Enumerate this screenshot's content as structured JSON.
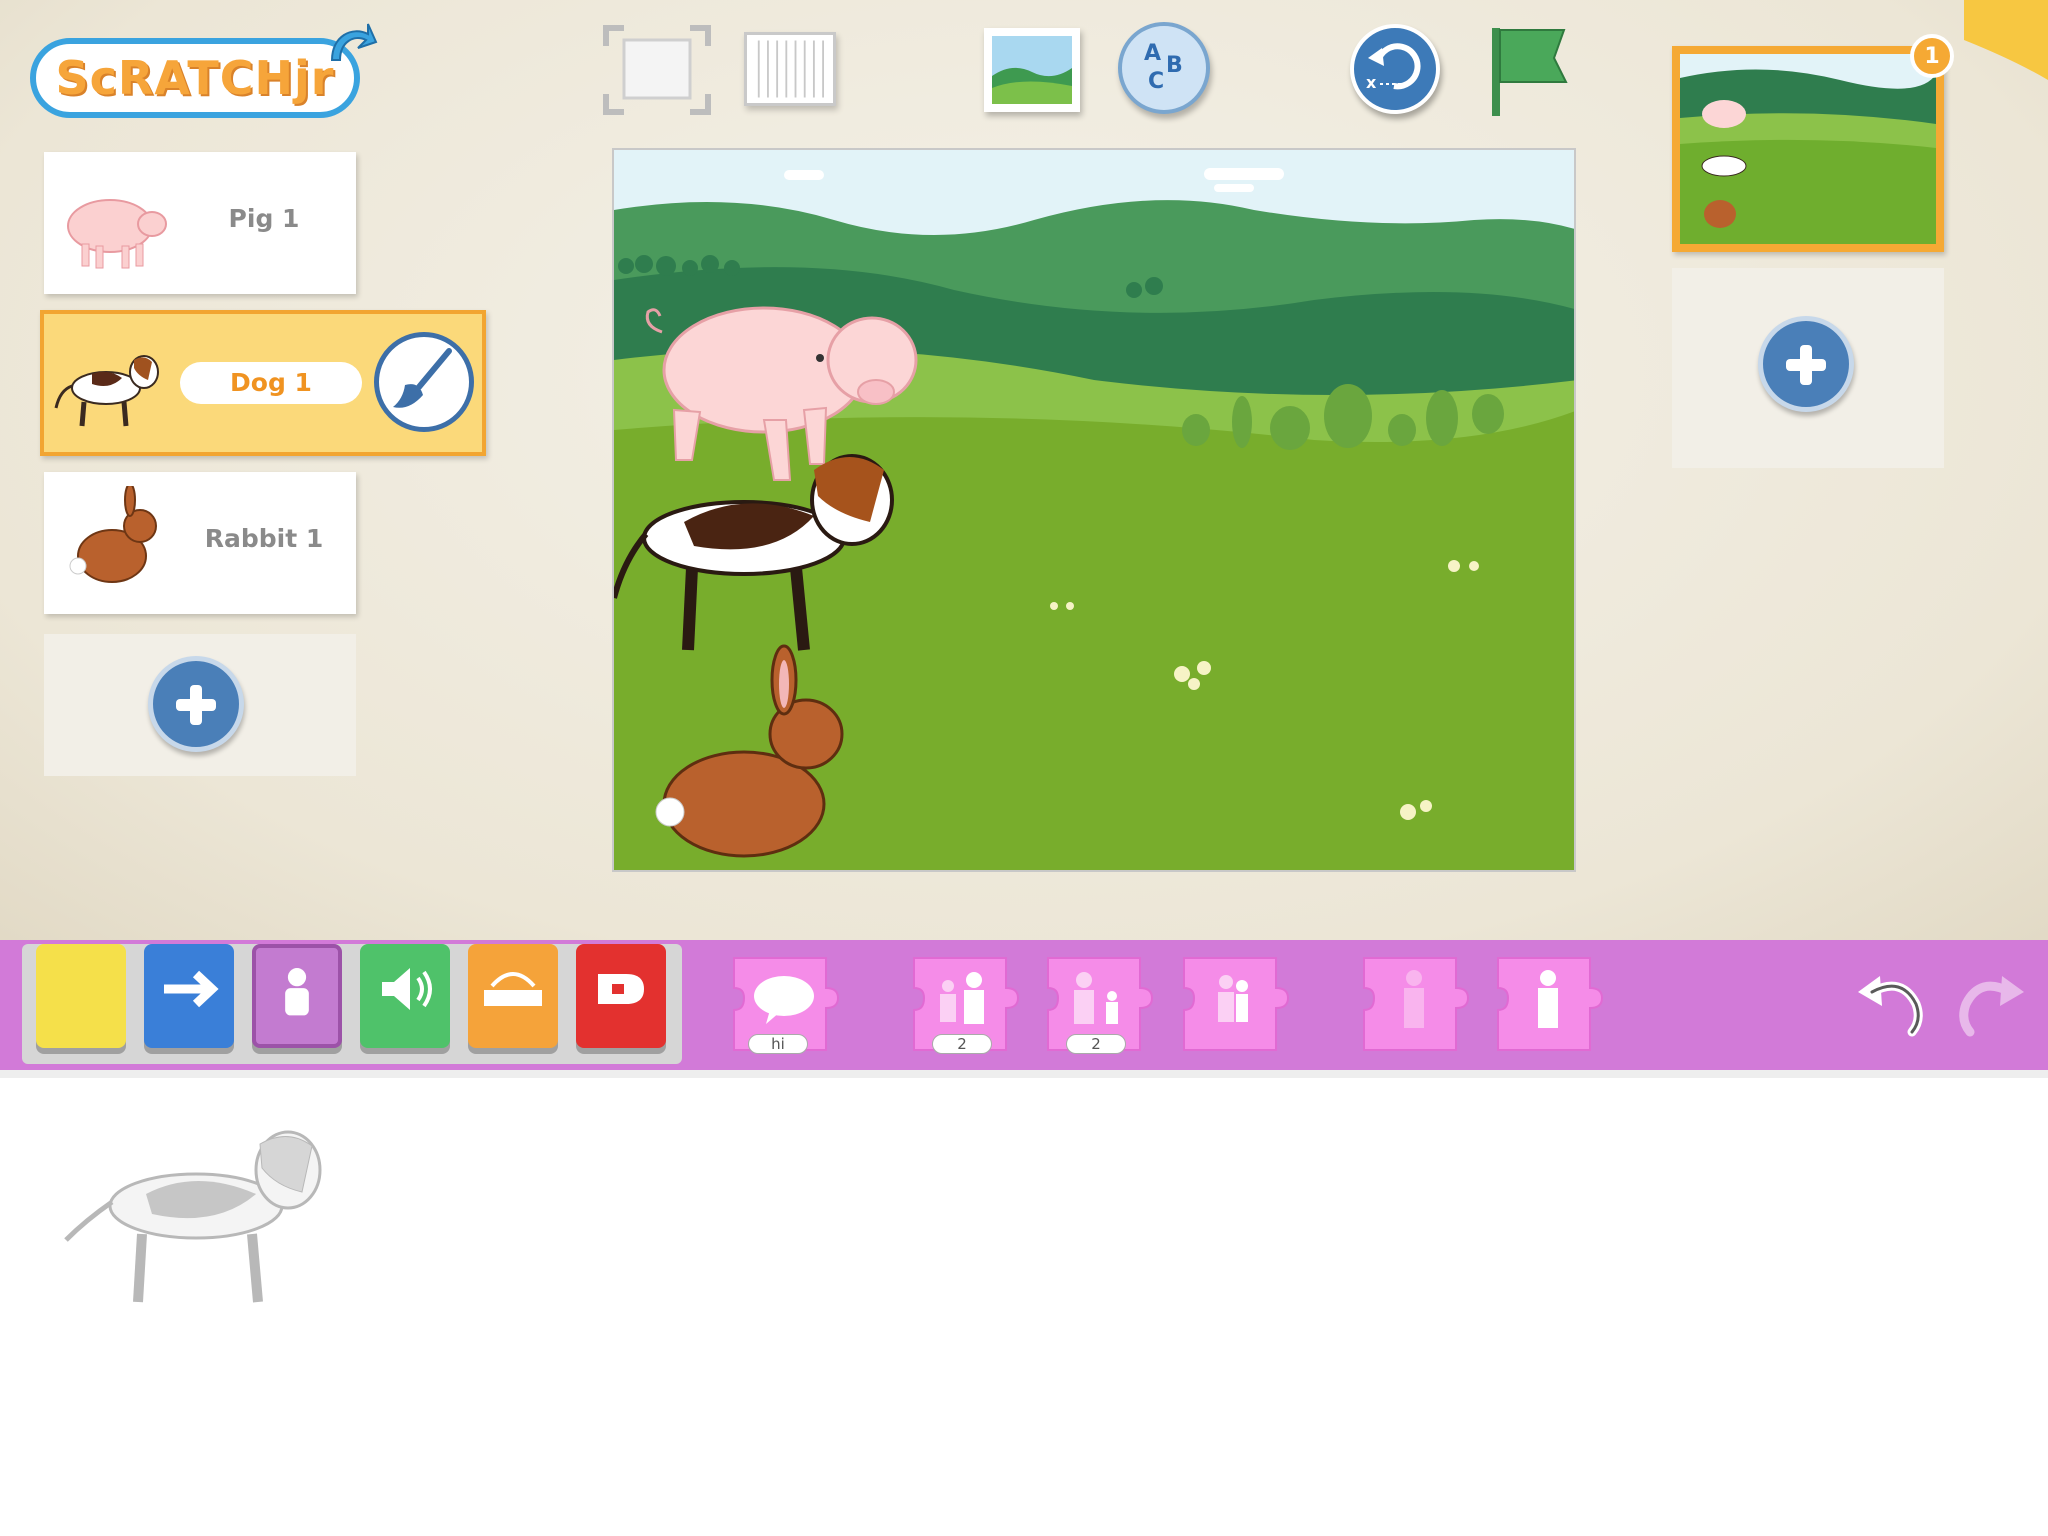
{
  "app": {
    "logo_text": "ScRATCHjr",
    "page_badge": "1"
  },
  "sprites": [
    {
      "name": "Pig 1",
      "selected": false
    },
    {
      "name": "Dog 1",
      "selected": true
    },
    {
      "name": "Rabbit 1",
      "selected": false
    }
  ],
  "toolbar": {
    "icons": [
      "fullscreen-icon",
      "grid-icon",
      "background-icon",
      "text-icon",
      "reset-icon",
      "green-flag-icon"
    ]
  },
  "categories": [
    {
      "name": "triggering",
      "color": "#f5e04a"
    },
    {
      "name": "motion",
      "color": "#3a7fd8"
    },
    {
      "name": "looks",
      "color": "#c37bd0"
    },
    {
      "name": "sound",
      "color": "#4fc26a"
    },
    {
      "name": "control",
      "color": "#f5a33a"
    },
    {
      "name": "end",
      "color": "#e3312f"
    }
  ],
  "blocks": [
    {
      "name": "say",
      "label": "hi"
    },
    {
      "name": "grow",
      "label": "2"
    },
    {
      "name": "shrink",
      "label": "2"
    },
    {
      "name": "reset-size",
      "label": ""
    },
    {
      "name": "hide",
      "label": ""
    },
    {
      "name": "show",
      "label": ""
    }
  ],
  "colors": {
    "palette_bar": "#d27ad8",
    "block_pink": "#f58ce8",
    "accent_orange": "#f5a934",
    "selection_yellow": "#fbd97a"
  }
}
